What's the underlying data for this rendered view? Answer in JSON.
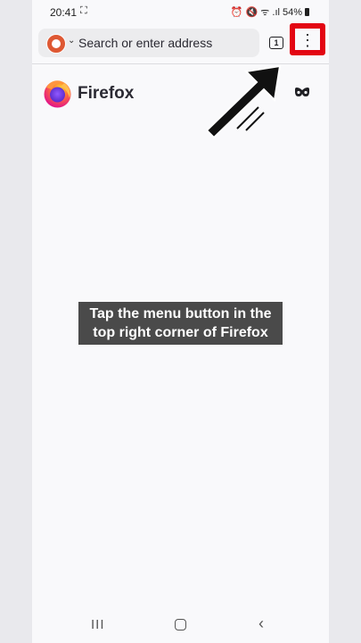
{
  "status_bar": {
    "time": "20:41",
    "screen_icon": "⛶",
    "status_icons": "⏰ 🔇 ᯤ .ıl",
    "battery": "54%"
  },
  "toolbar": {
    "engine_icon": "duckduckgo-icon",
    "search_placeholder": "Search or enter address",
    "tab_count": "1",
    "menu_glyph": "⋮"
  },
  "homepage": {
    "wordmark": "Firefox"
  },
  "caption": "Tap the menu button in the top right corner of Firefox",
  "nav_bar": {
    "recents_glyph": "III",
    "back_glyph": "‹"
  },
  "colors": {
    "highlight": "#e30613",
    "page_background": "#f9f9fb",
    "side_background": "#e9e9ed"
  }
}
